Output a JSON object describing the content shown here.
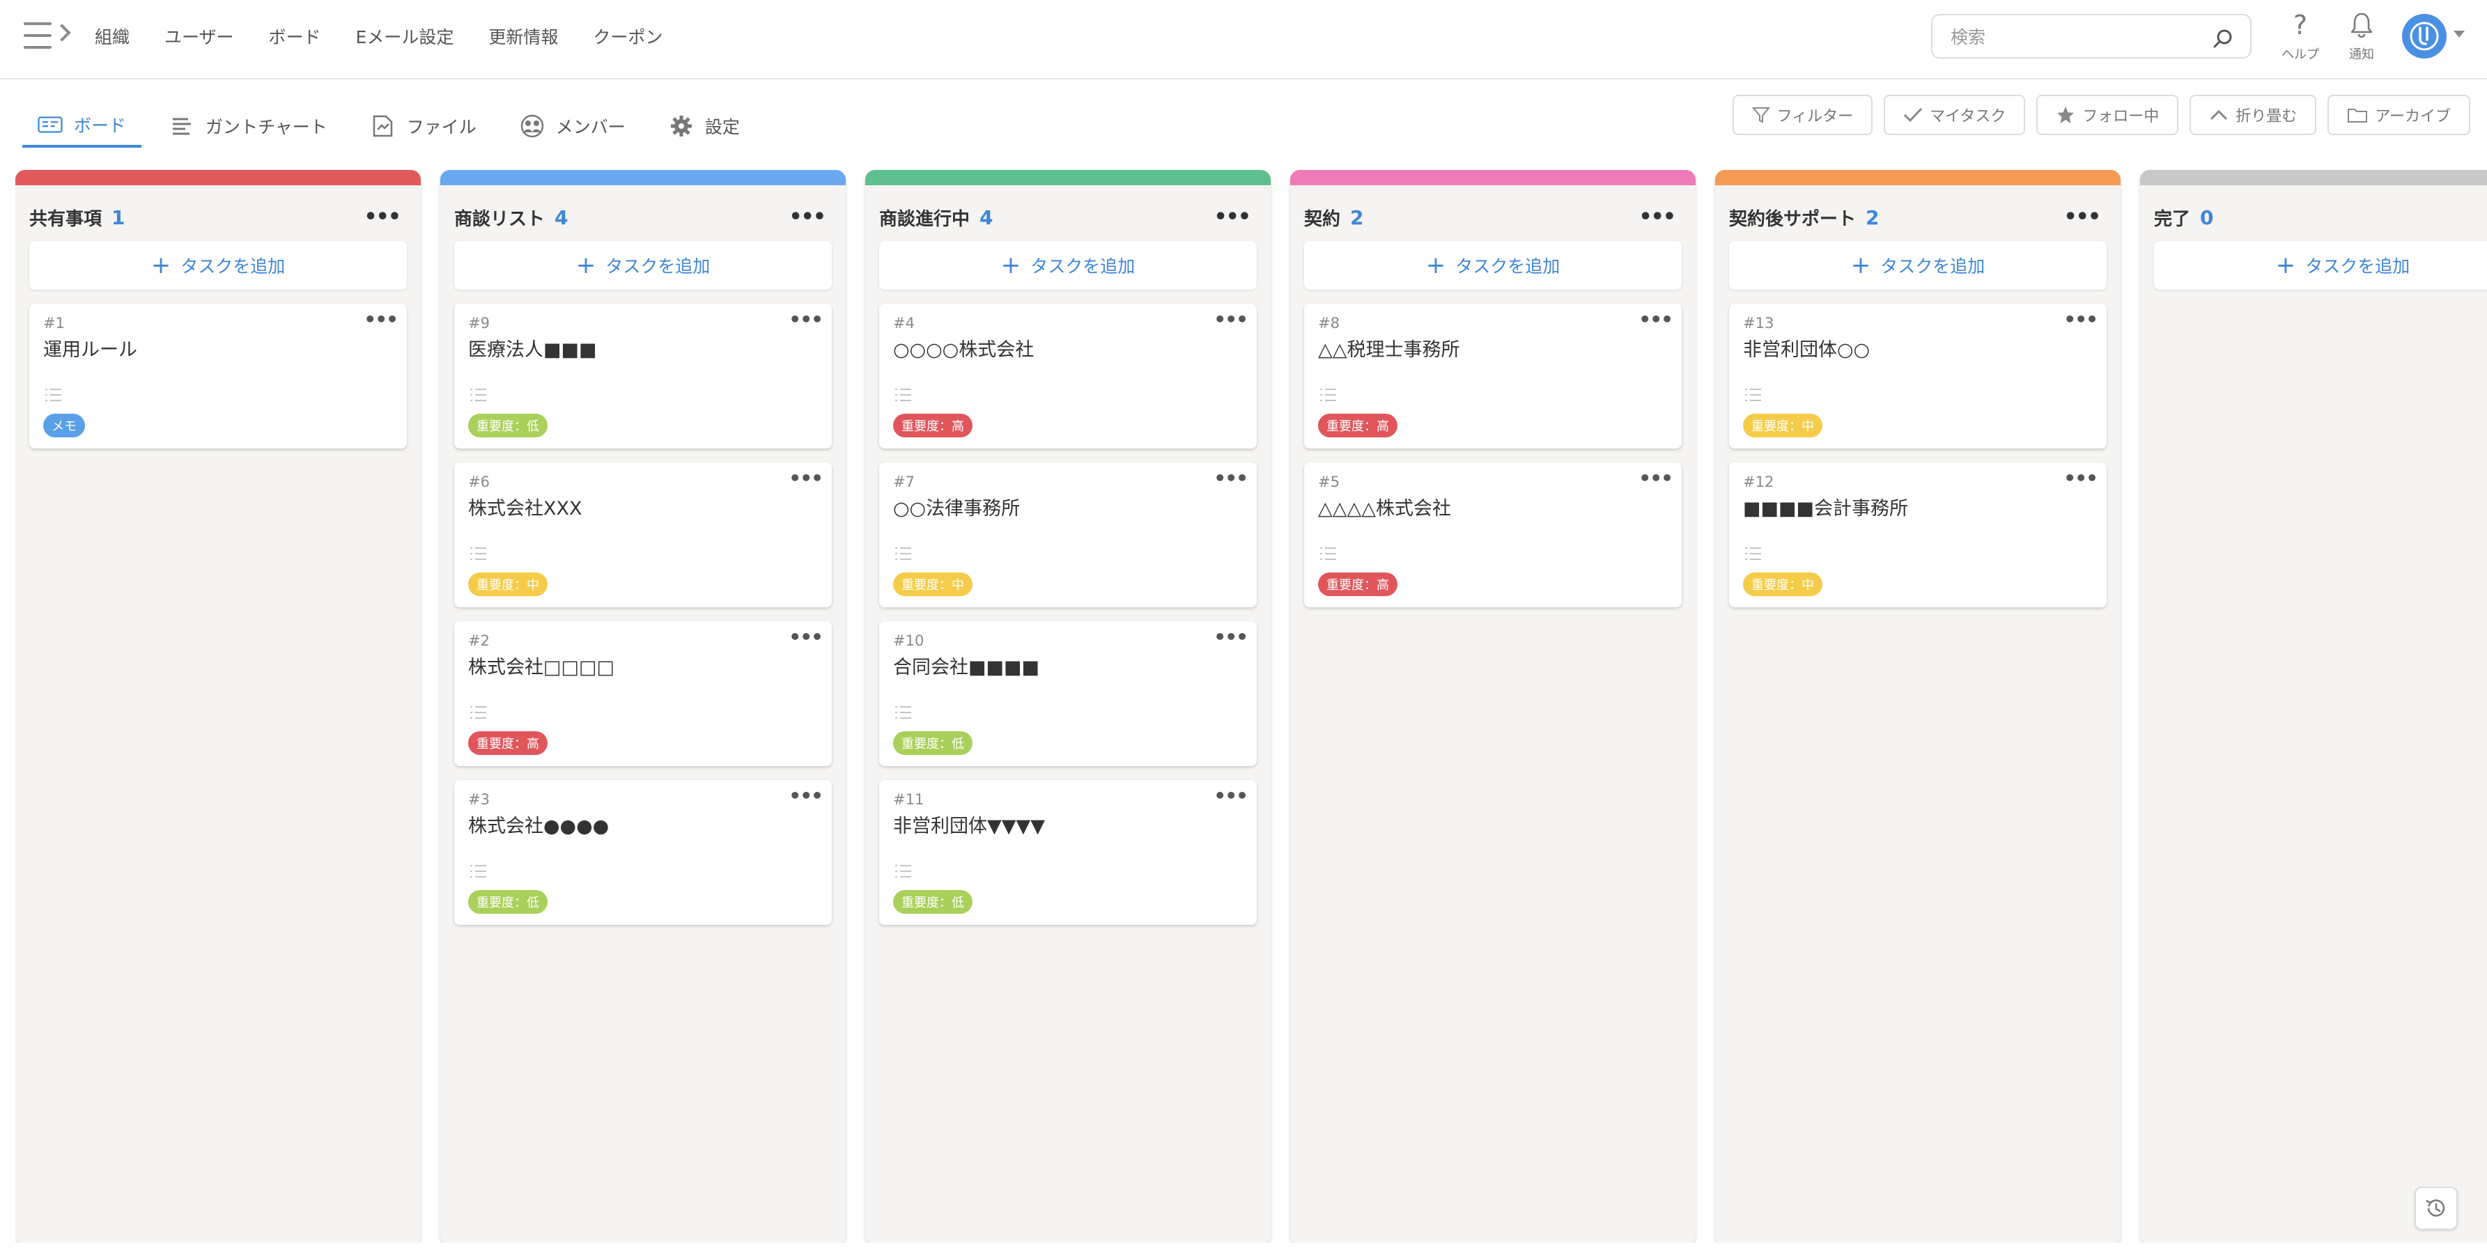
{
  "topnav": {
    "items": [
      "組織",
      "ユーザー",
      "ボード",
      "Eメール設定",
      "更新情報",
      "クーポン"
    ],
    "search_placeholder": "検索",
    "help_label": "ヘルプ",
    "notify_label": "通知"
  },
  "subnav": {
    "tabs": [
      "ボード",
      "ガントチャート",
      "ファイル",
      "メンバー",
      "設定"
    ],
    "active": "ボード"
  },
  "tools": [
    "フィルター",
    "マイタスク",
    "フォロー中",
    "折り畳む",
    "アーカイブ"
  ],
  "board": {
    "add_task_label": "タスクを追加",
    "columns": [
      {
        "title": "共有事項",
        "count": "1",
        "color": "#e05a5a",
        "cards": [
          {
            "id": "#1",
            "title": "運用ルール",
            "badge": "メモ",
            "badge_color": "#5aa0e8"
          }
        ]
      },
      {
        "title": "商談リスト",
        "count": "4",
        "color": "#6aa8f0",
        "cards": [
          {
            "id": "#9",
            "title": "医療法人■■■",
            "badge": "重要度：低",
            "badge_color": "#a8d05a"
          },
          {
            "id": "#6",
            "title": "株式会社XXX",
            "badge": "重要度：中",
            "badge_color": "#f5cc4a"
          },
          {
            "id": "#2",
            "title": "株式会社□□□□",
            "badge": "重要度：高",
            "badge_color": "#e0565b"
          },
          {
            "id": "#3",
            "title": "株式会社●●●●",
            "badge": "重要度：低",
            "badge_color": "#a8d05a"
          }
        ]
      },
      {
        "title": "商談進行中",
        "count": "4",
        "color": "#5fbf8f",
        "cards": [
          {
            "id": "#4",
            "title": "○○○○株式会社",
            "badge": "重要度：高",
            "badge_color": "#e0565b"
          },
          {
            "id": "#7",
            "title": "○○法律事務所",
            "badge": "重要度：中",
            "badge_color": "#f5cc4a"
          },
          {
            "id": "#10",
            "title": "合同会社■■■■",
            "badge": "重要度：低",
            "badge_color": "#a8d05a"
          },
          {
            "id": "#11",
            "title": "非営利団体▼▼▼▼",
            "badge": "重要度：低",
            "badge_color": "#a8d05a"
          }
        ]
      },
      {
        "title": "契約",
        "count": "2",
        "color": "#ee7bb8",
        "cards": [
          {
            "id": "#8",
            "title": "△△税理士事務所",
            "badge": "重要度：高",
            "badge_color": "#e0565b"
          },
          {
            "id": "#5",
            "title": "△△△△株式会社",
            "badge": "重要度：高",
            "badge_color": "#e0565b"
          }
        ]
      },
      {
        "title": "契約後サポート",
        "count": "2",
        "color": "#f59a55",
        "cards": [
          {
            "id": "#13",
            "title": "非営利団体○○",
            "badge": "重要度：中",
            "badge_color": "#f5cc4a"
          },
          {
            "id": "#12",
            "title": "■■■■会計事務所",
            "badge": "重要度：中",
            "badge_color": "#f5cc4a"
          }
        ]
      },
      {
        "title": "完了",
        "count": "0",
        "color": "#c8c8c8",
        "cards": []
      }
    ]
  }
}
